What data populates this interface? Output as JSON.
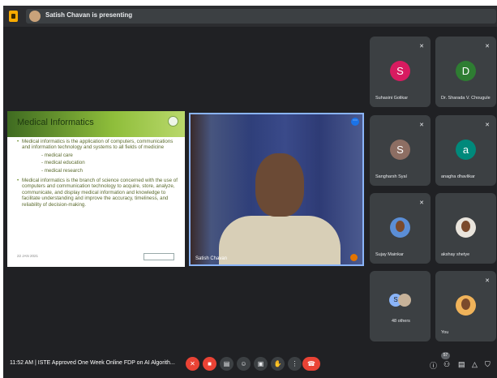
{
  "topbar": {
    "presenting_text": "Satish Chavan is presenting"
  },
  "slide": {
    "title": "Medical Informatics",
    "bullet1": "Medical informatics is the application of computers, communications and information technology and systems to all fields of medicine",
    "sub_items": [
      "- medical care",
      "- medical education",
      "- medical research"
    ],
    "bullet2": "Medical informatics is the branch of science concerned with the use of computers and communication technology to acquire, store, analyze, communicate, and display medical information and knowledge to facilitate understanding and improve the accuracy, timeliness, and reliability of decision-making.",
    "date": "22 JAN 2021"
  },
  "camera": {
    "name": "Satish Chavan"
  },
  "participants": [
    {
      "name": "Suhasini Golikar",
      "initial": "S",
      "color": "#d81b60"
    },
    {
      "name": "Dr. Sharada V. Chougule",
      "initial": "D",
      "color": "#2e7d32"
    },
    {
      "name": "Sangharsh Syal",
      "initial": "S",
      "color": "#8d6e63"
    },
    {
      "name": "anagha dhavlikar",
      "initial": "a",
      "color": "#00897b"
    },
    {
      "name": "Sujay Mainkar"
    },
    {
      "name": "akshay shetye"
    },
    {
      "name": "48 others"
    },
    {
      "name": "You"
    }
  ],
  "bottombar": {
    "time_meeting": "11:52 AM  |  ISTE Approved One Week Online FDP on AI Algorith...",
    "people_badge": "57"
  },
  "icons": {
    "mic_off": "mic-off-icon",
    "cam_off": "cam-off-icon",
    "captions": "captions-icon",
    "emoji": "emoji-icon",
    "present": "present-icon",
    "raise_hand": "raise-hand-icon",
    "more": "more-icon",
    "end_call": "end-call-icon"
  }
}
